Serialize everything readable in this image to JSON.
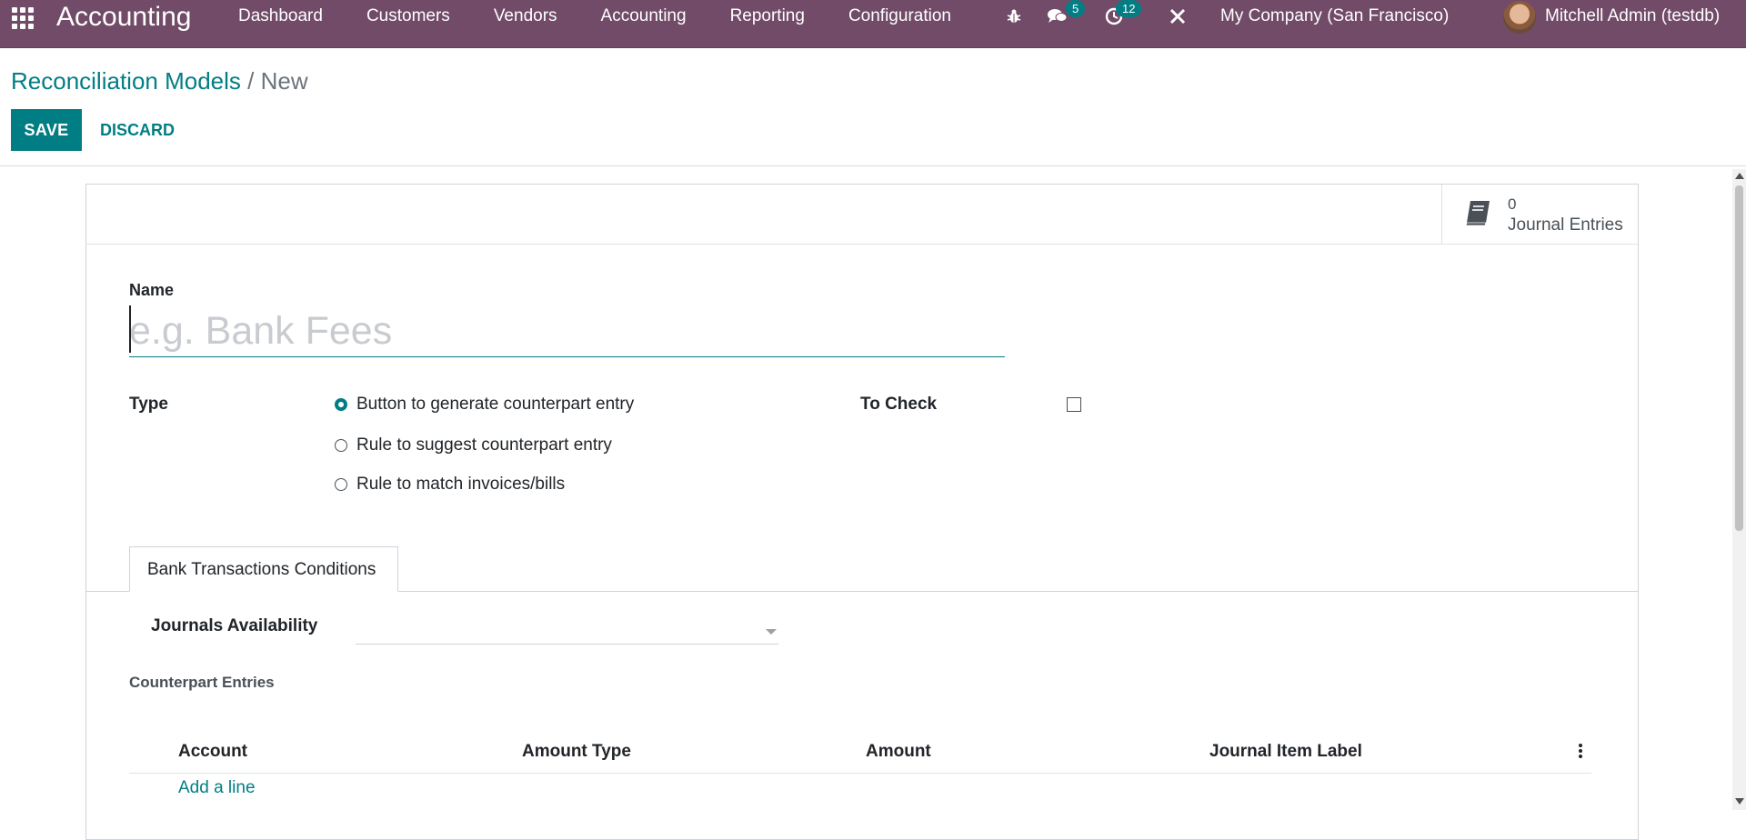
{
  "navbar": {
    "app_title": "Accounting",
    "menu": [
      "Dashboard",
      "Customers",
      "Vendors",
      "Accounting",
      "Reporting",
      "Configuration"
    ],
    "messages_badge": "5",
    "activities_badge": "12",
    "company": "My Company (San Francisco)",
    "user": "Mitchell Admin (testdb)"
  },
  "breadcrumb": {
    "parent": "Reconciliation Models",
    "separator": "/",
    "current": "New"
  },
  "toolbar": {
    "save_label": "SAVE",
    "discard_label": "DISCARD"
  },
  "stat_button": {
    "value": "0",
    "label": "Journal Entries"
  },
  "form": {
    "name_label": "Name",
    "name_placeholder": "e.g. Bank Fees",
    "type_label": "Type",
    "type_options": [
      {
        "label": "Button to generate counterpart entry",
        "checked": true
      },
      {
        "label": "Rule to suggest counterpart entry",
        "checked": false
      },
      {
        "label": "Rule to match invoices/bills",
        "checked": false
      }
    ],
    "to_check_label": "To Check",
    "to_check_value": false
  },
  "notebook": {
    "tab_label": "Bank Transactions Conditions",
    "journals_label": "Journals Availability",
    "counterpart_label": "Counterpart Entries",
    "columns": [
      "Account",
      "Amount Type",
      "Amount",
      "Journal Item Label"
    ],
    "add_line": "Add a line"
  },
  "colors": {
    "navbar": "#714b67",
    "accent": "#017e84"
  }
}
